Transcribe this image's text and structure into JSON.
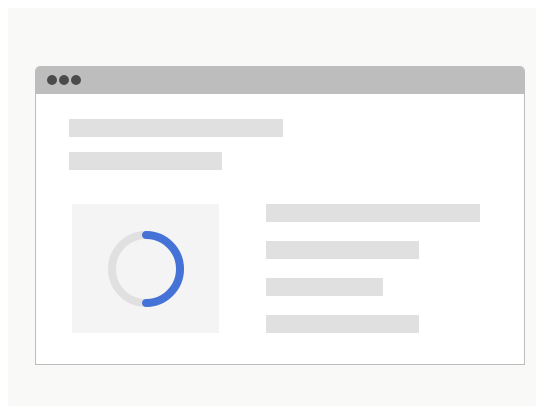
{
  "window": {
    "titlebar": {
      "controls": [
        "window-dot",
        "window-dot",
        "window-dot"
      ]
    }
  },
  "content": {
    "placeholders": {
      "title": "",
      "subtitle": "",
      "lines": [
        "",
        "",
        "",
        ""
      ]
    },
    "loading_spinner": {
      "icon": "loading-spinner-icon",
      "progress": 0.5
    }
  },
  "colors": {
    "page_background": "#f9faf8",
    "titlebar": "#bdbdbd",
    "window_dot": "#4b4b4b",
    "skeleton": "#e0e0e0",
    "card_background": "#f4f4f4",
    "spinner_track": "#e0e0e0",
    "spinner_accent": "#4472d6"
  }
}
